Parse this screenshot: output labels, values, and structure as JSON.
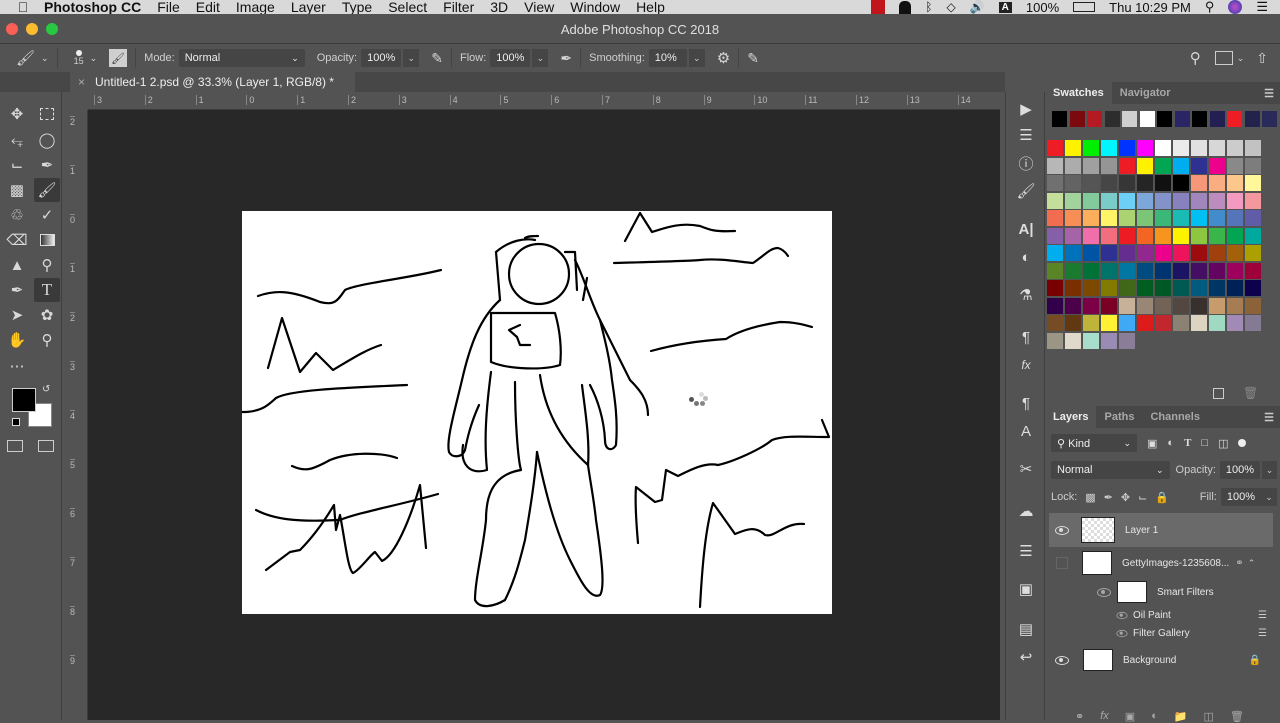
{
  "menubar": {
    "app_name": "Photoshop CC",
    "menus": [
      "File",
      "Edit",
      "Image",
      "Layer",
      "Type",
      "Select",
      "Filter",
      "3D",
      "View",
      "Window",
      "Help"
    ],
    "battery": "100%",
    "clock": "Thu 10:29 PM",
    "input_source": "A"
  },
  "window": {
    "title": "Adobe Photoshop CC 2018"
  },
  "options": {
    "brush_size": "15",
    "mode_label": "Mode:",
    "mode_value": "Normal",
    "opacity_label": "Opacity:",
    "opacity_value": "100%",
    "flow_label": "Flow:",
    "flow_value": "100%",
    "smoothing_label": "Smoothing:",
    "smoothing_value": "10%"
  },
  "document": {
    "tab_title": "Untitled-1 2.psd @ 33.3% (Layer 1, RGB/8) *",
    "close_glyph": "×"
  },
  "rulers": {
    "horizontal": [
      "3",
      "2",
      "1",
      "0",
      "1",
      "2",
      "3",
      "4",
      "5",
      "6",
      "7",
      "8",
      "9",
      "10",
      "11",
      "12",
      "13",
      "14"
    ],
    "vertical": [
      "2",
      "1",
      "0",
      "1",
      "2",
      "3",
      "4",
      "5",
      "6",
      "7",
      "8",
      "9"
    ]
  },
  "colors": {
    "foreground": "#000000",
    "background": "#ffffff",
    "close": "#fc5f57",
    "minimize": "#fdbc2e",
    "zoom": "#28c840"
  },
  "swatches_panel": {
    "tabs": [
      "Swatches",
      "Navigator"
    ],
    "recent": [
      "#000000",
      "#7a0a0e",
      "#b41a22",
      "#2d2d2d",
      "#cfcfcf",
      "#ffffff",
      "#000000",
      "#2a2666",
      "#000000",
      "#222052",
      "#ee1c24",
      "#23224d",
      "#2a2a5a"
    ],
    "grid": [
      [
        "#ee1c24",
        "#fff200",
        "#00ee00",
        "#00f5ff",
        "#0033ff",
        "#ff00ff",
        "#ffffff",
        "#ebebeb",
        "#e1e1e1",
        "#d7d7d7",
        "#cccccc",
        "#c2c2c2"
      ],
      [
        "#b7b7b7",
        "#acacac",
        "#a0a0a0",
        "#959595",
        "#ee1c24",
        "#fff200",
        "#00a651",
        "#00aeef",
        "#2e3192",
        "#ec008c",
        "#898989",
        "#7d7d7d"
      ],
      [
        "#707070",
        "#636363",
        "#555555",
        "#464646",
        "#363636",
        "#252525",
        "#111111",
        "#000000",
        "#f7977a",
        "#f9ad81",
        "#fdc68a",
        "#fff79a"
      ],
      [
        "#c4df9b",
        "#a3d39c",
        "#82ca9c",
        "#7accc8",
        "#6dcff6",
        "#7da7d9",
        "#8393ca",
        "#8781bd",
        "#a186be",
        "#bd8cbf",
        "#f49ac1",
        "#f5989d"
      ],
      [
        "#f26c4f",
        "#f68e55",
        "#fbaf5c",
        "#fff467",
        "#acd372",
        "#7cc576",
        "#3bb878",
        "#1abbb4",
        "#00bff3",
        "#438ccb",
        "#5574b9",
        "#605ca8"
      ],
      [
        "#8560a8",
        "#a763a8",
        "#f06eaa",
        "#f26d7d",
        "#ed1c24",
        "#f26522",
        "#f7941d",
        "#fff200",
        "#8dc63f",
        "#39b54a",
        "#00a651",
        "#00a99d"
      ],
      [
        "#00aeef",
        "#0072bc",
        "#0054a6",
        "#2e3192",
        "#662d91",
        "#92278f",
        "#ec008c",
        "#ed145b",
        "#9e0b0f",
        "#a0410d",
        "#a36209",
        "#aba000"
      ],
      [
        "#598527",
        "#1a7b30",
        "#007236",
        "#00746b",
        "#0076a3",
        "#004b80",
        "#003471",
        "#1b1464",
        "#440e62",
        "#630460",
        "#9e005d",
        "#9e0039"
      ],
      [
        "#790000",
        "#7b2e00",
        "#7d4900",
        "#827b00",
        "#406618",
        "#005e20",
        "#005826",
        "#005952",
        "#005b7f",
        "#003663",
        "#002157",
        "#0d004c"
      ],
      [
        "#32004b",
        "#4b0049",
        "#7b0046",
        "#7a0026",
        "#c7b299",
        "#998675",
        "#736357",
        "#534741",
        "#37302d",
        "#c69c6d",
        "#a67c52",
        "#8c6239"
      ],
      [
        "#754c24",
        "#603913",
        "#bfb43a",
        "#fff234",
        "#3fa9f5",
        "#dd1b1b",
        "#c1272d",
        "#8c8274",
        "#ddd3c1",
        "#a0d9c1",
        "#a18ab6",
        "#857a93"
      ],
      [
        "#9b9586",
        "#e0d9cb",
        "#a8dccb",
        "#9a8bb5",
        "#8a7d97"
      ]
    ]
  },
  "layers_panel": {
    "tabs": [
      "Layers",
      "Paths",
      "Channels"
    ],
    "filter_label": "Kind",
    "blend_mode": "Normal",
    "opacity_label": "Opacity:",
    "opacity_value": "100%",
    "lock_label": "Lock:",
    "fill_label": "Fill:",
    "fill_value": "100%",
    "layers": [
      {
        "name": "Layer 1",
        "visible": true,
        "selected": true
      },
      {
        "name": "GettyImages-1235608...",
        "visible": false,
        "selected": false
      },
      {
        "name": "Smart Filters",
        "visible": true,
        "selected": false
      },
      {
        "name": "Oil Paint",
        "visible": true,
        "selected": false
      },
      {
        "name": "Filter Gallery",
        "visible": true,
        "selected": false
      },
      {
        "name": "Background",
        "visible": true,
        "selected": false,
        "locked": true
      }
    ]
  }
}
